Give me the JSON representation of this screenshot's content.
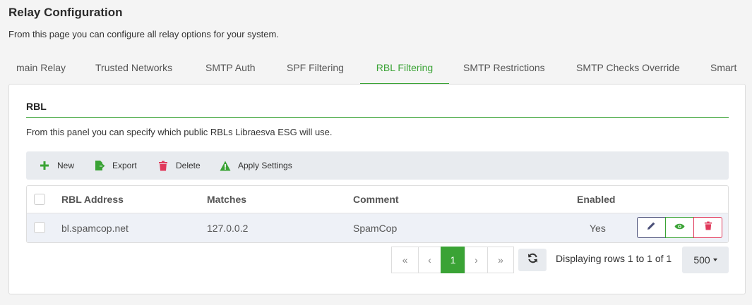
{
  "page": {
    "title": "Relay Configuration",
    "description": "From this page you can configure all relay options for your system."
  },
  "tabs": [
    {
      "label": "main Relay"
    },
    {
      "label": "Trusted Networks"
    },
    {
      "label": "SMTP Auth"
    },
    {
      "label": "SPF Filtering"
    },
    {
      "label": "RBL Filtering",
      "active": true
    },
    {
      "label": "SMTP Restrictions"
    },
    {
      "label": "SMTP Checks Override"
    },
    {
      "label": "Smart"
    }
  ],
  "panel": {
    "title": "RBL",
    "description": "From this panel you can specify which public RBLs Libraesva ESG will use."
  },
  "toolbar": {
    "new_label": "New",
    "export_label": "Export",
    "delete_label": "Delete",
    "apply_label": "Apply Settings"
  },
  "table": {
    "columns": [
      "RBL Address",
      "Matches",
      "Comment",
      "Enabled"
    ],
    "rows": [
      {
        "address": "bl.spamcop.net",
        "matches": "127.0.0.2",
        "comment": "SpamCop",
        "enabled": "Yes"
      }
    ]
  },
  "pagination": {
    "first": "«",
    "prev": "‹",
    "current_page": "1",
    "next": "›",
    "last": "»",
    "rows_info": "Displaying rows 1 to 1 of 1",
    "page_size": "500"
  },
  "colors": {
    "accent": "#3aa335",
    "danger": "#e0385a",
    "edit": "#4a4f78"
  },
  "icons": {
    "new": "plus-icon",
    "export": "export-file-icon",
    "delete": "trash-icon",
    "apply": "warning-icon",
    "edit": "pencil-icon",
    "view": "eye-icon",
    "row_delete": "trash-icon",
    "refresh": "refresh-icon",
    "caret": "caret-down-icon"
  }
}
